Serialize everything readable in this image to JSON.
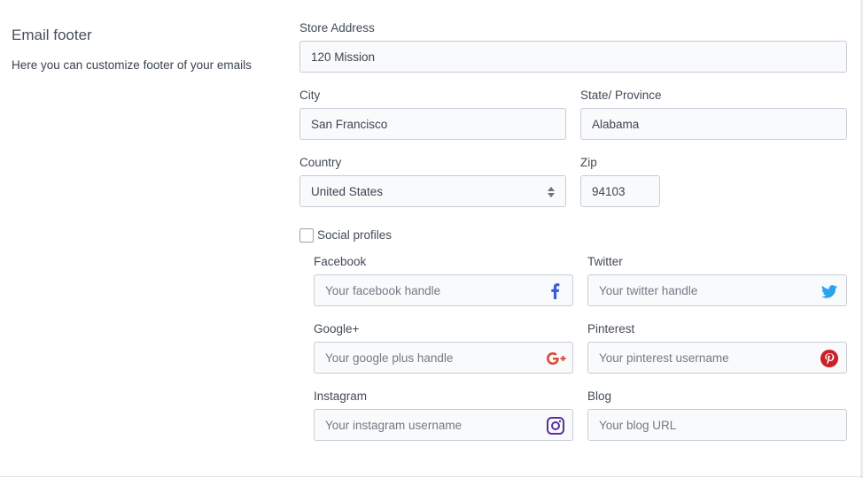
{
  "section": {
    "title": "Email footer",
    "description": "Here you can customize footer of your emails"
  },
  "address": {
    "store_address_label": "Store Address",
    "store_address_value": "120 Mission",
    "city_label": "City",
    "city_value": "San Francisco",
    "state_label": "State/ Province",
    "state_value": "Alabama",
    "country_label": "Country",
    "country_value": "United States",
    "zip_label": "Zip",
    "zip_value": "94103"
  },
  "social": {
    "checkbox_label": "Social profiles",
    "checked": false,
    "facebook": {
      "label": "Facebook",
      "placeholder": "Your facebook handle",
      "icon": "facebook-icon",
      "color": "#3b5bdb"
    },
    "twitter": {
      "label": "Twitter",
      "placeholder": "Your twitter handle",
      "icon": "twitter-icon",
      "color": "#2aa3ef"
    },
    "google": {
      "label": "Google+",
      "placeholder": "Your google plus handle",
      "icon": "google-plus-icon",
      "color": "#dc4a38"
    },
    "pinterest": {
      "label": "Pinterest",
      "placeholder": "Your pinterest username",
      "icon": "pinterest-icon",
      "color": "#cb2027"
    },
    "instagram": {
      "label": "Instagram",
      "placeholder": "Your instagram username",
      "icon": "instagram-icon",
      "color": "#5b2fa0"
    },
    "blog": {
      "label": "Blog",
      "placeholder": "Your blog URL"
    }
  }
}
